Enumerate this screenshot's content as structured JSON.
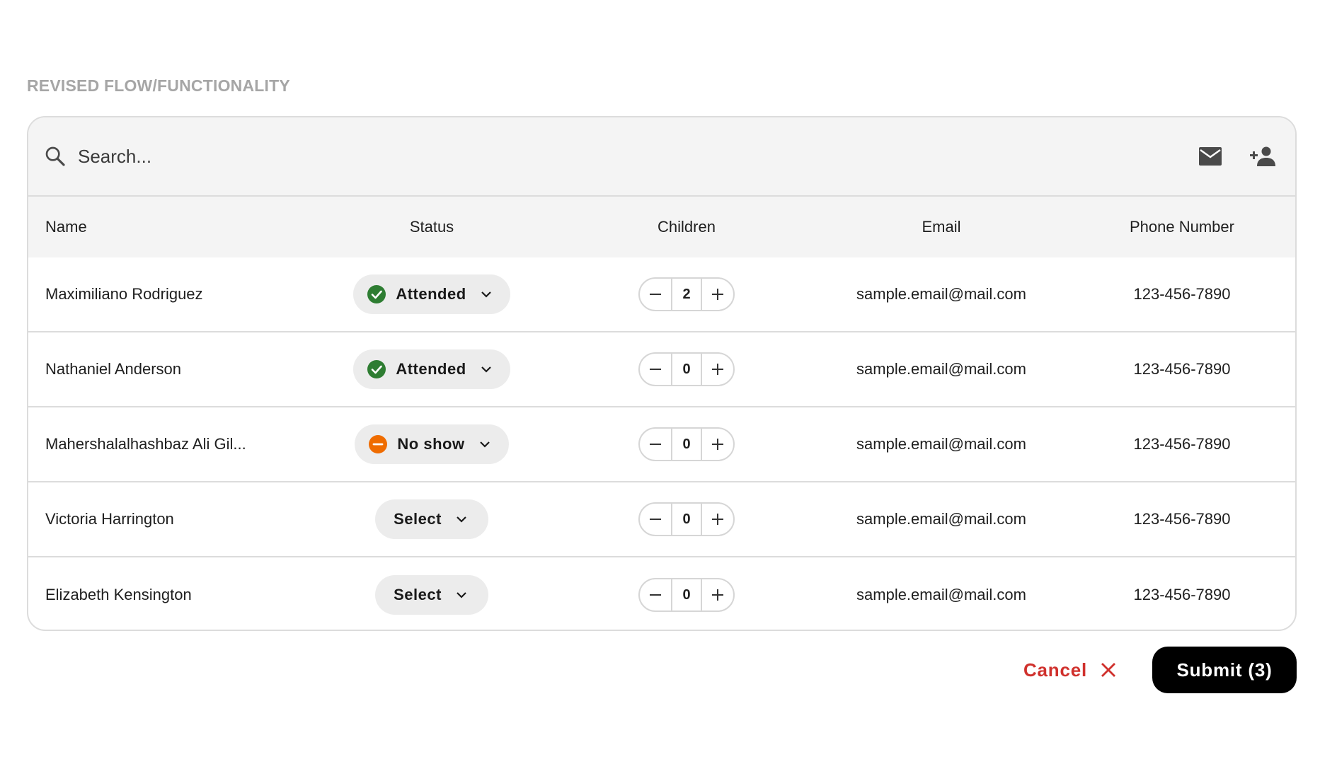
{
  "section_title": "REVISED FLOW/FUNCTIONALITY",
  "search": {
    "placeholder": "Search..."
  },
  "toolbar": {
    "email_icon": "mail-icon",
    "add_person_icon": "add-person-icon"
  },
  "columns": [
    "Name",
    "Status",
    "Children",
    "Email",
    "Phone Number"
  ],
  "rows": [
    {
      "name": "Maximiliano Rodriguez",
      "status": "Attended",
      "status_type": "attended",
      "children": "2",
      "email": "sample.email@mail.com",
      "phone": "123-456-7890"
    },
    {
      "name": "Nathaniel Anderson",
      "status": "Attended",
      "status_type": "attended",
      "children": "0",
      "email": "sample.email@mail.com",
      "phone": "123-456-7890"
    },
    {
      "name": "Mahershalalhashbaz Ali Gil...",
      "status": "No show",
      "status_type": "noshow",
      "children": "0",
      "email": "sample.email@mail.com",
      "phone": "123-456-7890"
    },
    {
      "name": "Victoria Harrington",
      "status": "Select",
      "status_type": "select",
      "children": "0",
      "email": "sample.email@mail.com",
      "phone": "123-456-7890"
    },
    {
      "name": "Elizabeth Kensington",
      "status": "Select",
      "status_type": "select",
      "children": "0",
      "email": "sample.email@mail.com",
      "phone": "123-456-7890"
    }
  ],
  "footer": {
    "cancel_label": "Cancel",
    "submit_label": "Submit (3)"
  },
  "colors": {
    "attended": "#2e7d32",
    "noshow": "#ef6c00",
    "cancel": "#d0312d",
    "submit_bg": "#000000"
  }
}
